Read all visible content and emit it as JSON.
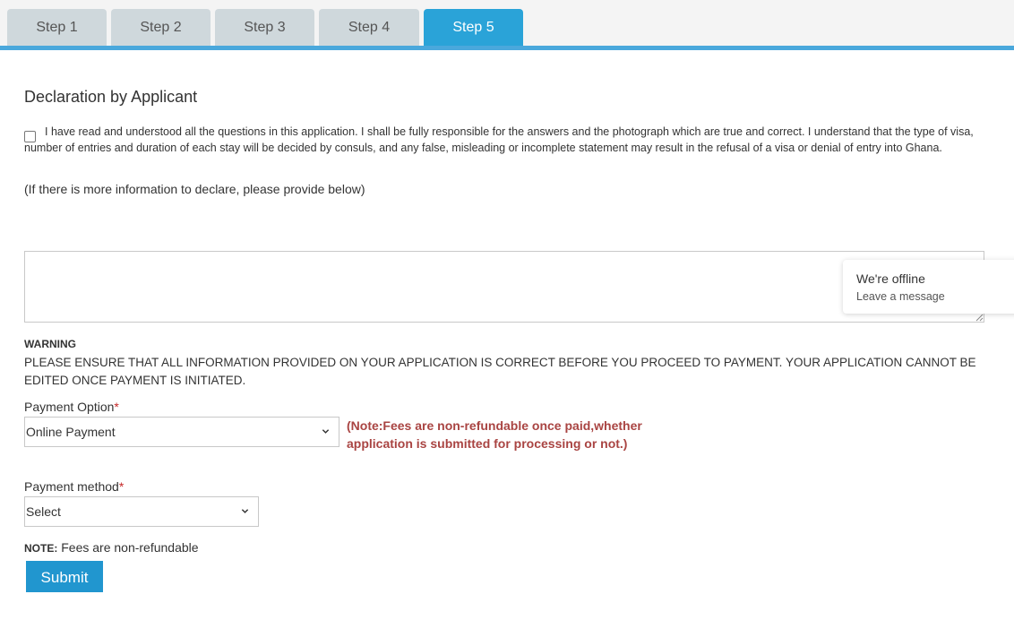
{
  "tabs": [
    {
      "label": "Step 1"
    },
    {
      "label": "Step 2"
    },
    {
      "label": "Step 3"
    },
    {
      "label": "Step 4"
    },
    {
      "label": "Step 5",
      "active": true
    }
  ],
  "declaration": {
    "heading": "Declaration by Applicant",
    "checkbox_checked": false,
    "text": "I have read and understood all the questions in this application. I shall be fully responsible for the answers and the photograph which are true and correct. I understand that the type of visa, number of entries and duration of each stay will be decided by consuls, and any false, misleading or incomplete statement may result in the refusal of a visa or denial of entry into Ghana.",
    "more_info_label": "(If there is more information to declare, please provide below)",
    "more_info_value": ""
  },
  "chat_widget": {
    "status": "We're offline",
    "action": "Leave a message"
  },
  "warning": {
    "title": "WARNING",
    "text": "PLEASE ENSURE THAT ALL INFORMATION PROVIDED ON YOUR APPLICATION IS CORRECT BEFORE YOU PROCEED TO PAYMENT. YOUR APPLICATION CANNOT BE EDITED ONCE PAYMENT IS INITIATED."
  },
  "payment_option": {
    "label": "Payment Option",
    "required_mark": "*",
    "selected": "Online Payment",
    "note": "(Note:Fees are non-refundable once paid,whether application is submitted for processing or not.)"
  },
  "payment_method": {
    "label": "Payment method",
    "required_mark": "*",
    "selected": "Select"
  },
  "note": {
    "prefix": "NOTE:",
    "text": " Fees are non-refundable"
  },
  "submit_label": "Submit",
  "colors": {
    "accent": "#2aa3d8",
    "tab_inactive": "#cfd8dc",
    "warning_red": "#a94442"
  }
}
